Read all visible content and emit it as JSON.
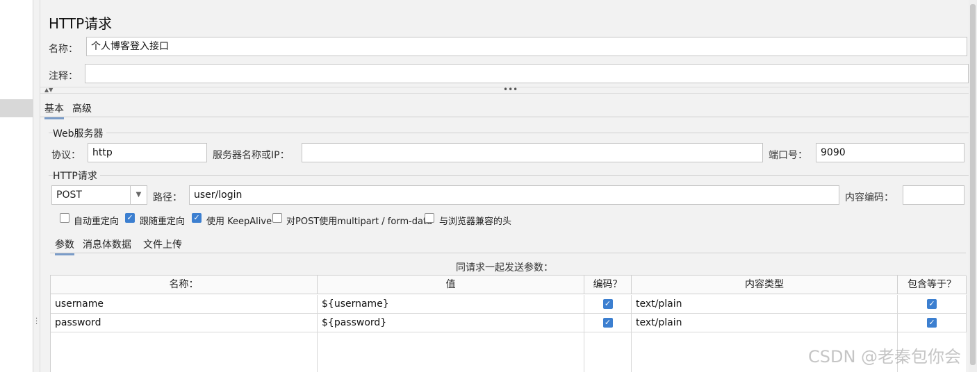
{
  "sampler": {
    "title": "HTTP请求",
    "name_label": "名称：",
    "name_value": "个人博客登入接口",
    "comment_label": "注释：",
    "comment_value": ""
  },
  "top_tabs": [
    {
      "label": "基本",
      "active": true
    },
    {
      "label": "高级",
      "active": false
    }
  ],
  "web_server": {
    "group_title": "Web服务器",
    "protocol_label": "协议：",
    "protocol_value": "http",
    "server_label": "服务器名称或IP：",
    "server_value": "",
    "port_label": "端口号：",
    "port_value": "9090"
  },
  "http_request": {
    "group_title": "HTTP请求",
    "method": "POST",
    "path_label": "路径：",
    "path_value": "user/login",
    "encoding_label": "内容编码：",
    "encoding_value": ""
  },
  "options": [
    {
      "label": "自动重定向",
      "checked": false
    },
    {
      "label": "跟随重定向",
      "checked": true
    },
    {
      "label": "使用 KeepAlive",
      "checked": true
    },
    {
      "label": "对POST使用multipart / form-data",
      "checked": false
    },
    {
      "label": "与浏览器兼容的头",
      "checked": false
    }
  ],
  "body_tabs": [
    {
      "label": "参数",
      "active": true
    },
    {
      "label": "消息体数据",
      "active": false
    },
    {
      "label": "文件上传",
      "active": false
    }
  ],
  "params": {
    "caption": "同请求一起发送参数：",
    "columns": [
      "名称：",
      "值",
      "编码？",
      "内容类型",
      "包含等于？"
    ],
    "rows": [
      {
        "name": "username",
        "value": "${username}",
        "encode": true,
        "content_type": "text/plain",
        "include_equals": true
      },
      {
        "name": "password",
        "value": "${password}",
        "encode": true,
        "content_type": "text/plain",
        "include_equals": true
      }
    ]
  },
  "watermark": "CSDN @老秦包你会",
  "icons": {
    "checkmark": "check-icon",
    "dropdown": "chevron-down-icon",
    "collapse": "collapse-arrows-icon",
    "drag": "drag-handle-icon"
  },
  "colors": {
    "accent": "#3c7fd0",
    "tab_underline": "#7a9cc8",
    "panel_bg": "#f2f2f2"
  }
}
